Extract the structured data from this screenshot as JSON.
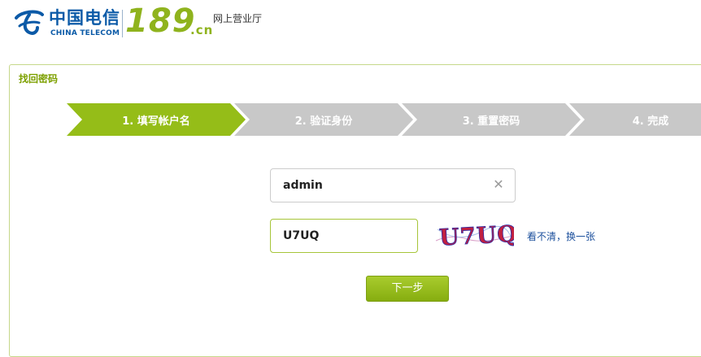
{
  "header": {
    "brand_cn": "中国电信",
    "brand_en": "CHINA TELECOM",
    "site_number": "189",
    "site_domain": ".cn",
    "site_title": "网上营业厅"
  },
  "panel": {
    "title": "找回密码"
  },
  "steps": [
    {
      "label": "1. 填写帐户名",
      "state": "active"
    },
    {
      "label": "2. 验证身份",
      "state": "inactive"
    },
    {
      "label": "3. 重置密码",
      "state": "inactive"
    },
    {
      "label": "4. 完成",
      "state": "inactive"
    }
  ],
  "form": {
    "username_value": "admin",
    "captcha_value": "U7UQ",
    "captcha_image_text": "U7UQ",
    "refresh_link": "看不清，换一张",
    "next_button": "下一步"
  },
  "colors": {
    "accent": "#95bd18",
    "brand_blue": "#0b5aa7",
    "step_inactive": "#c8c8c8",
    "link": "#1b4f9c"
  },
  "icons": {
    "clear": "close-icon",
    "logo": "china-telecom-logo-icon"
  }
}
